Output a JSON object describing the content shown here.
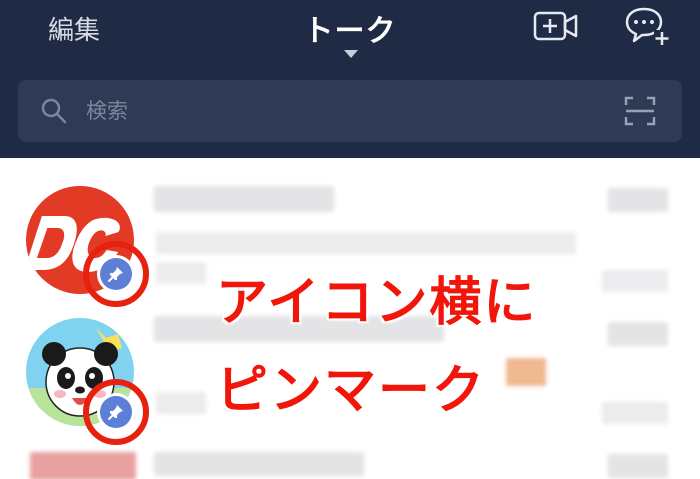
{
  "header": {
    "edit_label": "編集",
    "title": "トーク",
    "video_icon": "video-add-icon",
    "chat_icon": "new-chat-icon"
  },
  "search": {
    "placeholder": "検索",
    "icon": "search-icon",
    "scan_icon": "scan-icon"
  },
  "annotation": {
    "line1": "アイコン横に",
    "line2": "ピンマーク"
  },
  "colors": {
    "header_bg": "#1f2a45",
    "search_bg": "#2e3a56",
    "pin_blue": "#5d7fd6",
    "annotation_red": "#f2150a"
  }
}
